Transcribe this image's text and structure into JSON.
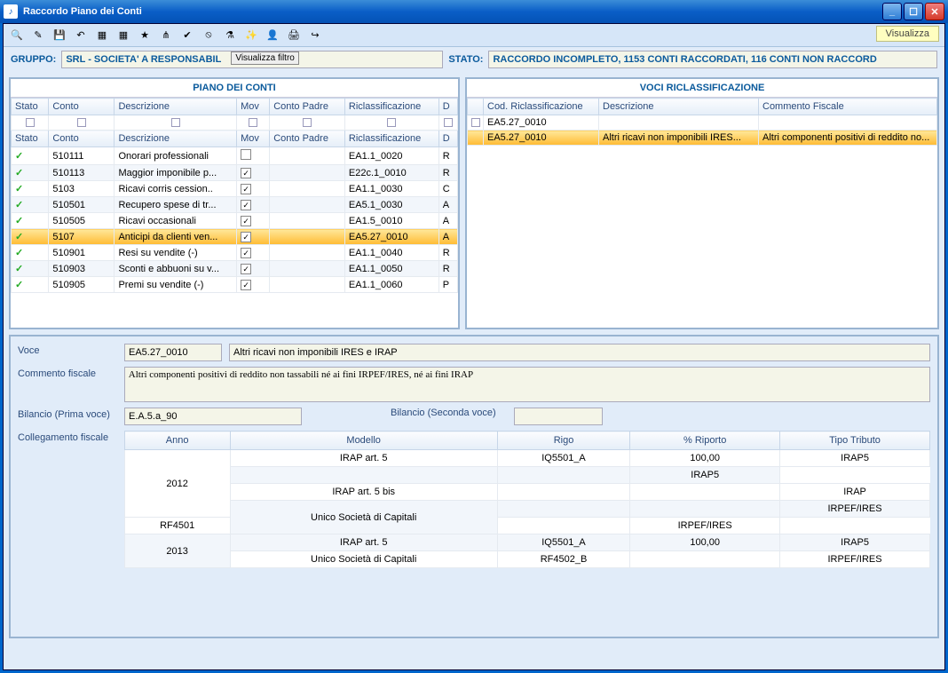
{
  "window": {
    "title": "Raccordo Piano dei Conti"
  },
  "toolbar": {
    "visualizza": "Visualizza",
    "filter_btn": "Visualizza filtro"
  },
  "filter": {
    "gruppo_label": "GRUPPO:",
    "gruppo_value": "SRL - SOCIETA' A RESPONSABIL",
    "stato_label": "STATO:",
    "stato_value": "RACCORDO INCOMPLETO, 1153 CONTI RACCORDATI, 116 CONTI NON RACCORD"
  },
  "panel_left": {
    "title": "PIANO DEI CONTI",
    "cols": [
      "Stato",
      "Conto",
      "Descrizione",
      "Mov",
      "Conto Padre",
      "Riclassificazione",
      "D"
    ],
    "rows": [
      {
        "conto": "510111",
        "descr": "Onorari professionali",
        "mov": false,
        "padre": "",
        "ricl": "EA1.1_0020",
        "d": "R"
      },
      {
        "conto": "510113",
        "descr": "Maggior imponibile p...",
        "mov": true,
        "padre": "",
        "ricl": "E22c.1_0010",
        "d": "R"
      },
      {
        "conto": "5103",
        "descr": "Ricavi corris cession..",
        "mov": true,
        "padre": "",
        "ricl": "EA1.1_0030",
        "d": "C"
      },
      {
        "conto": "510501",
        "descr": "Recupero spese di tr...",
        "mov": true,
        "padre": "",
        "ricl": "EA5.1_0030",
        "d": "A"
      },
      {
        "conto": "510505",
        "descr": "Ricavi occasionali",
        "mov": true,
        "padre": "",
        "ricl": "EA1.5_0010",
        "d": "A"
      },
      {
        "conto": "5107",
        "descr": "Anticipi da clienti ven...",
        "mov": true,
        "padre": "",
        "ricl": "EA5.27_0010",
        "d": "A",
        "selected": true
      },
      {
        "conto": "510901",
        "descr": "Resi su vendite (-)",
        "mov": true,
        "padre": "",
        "ricl": "EA1.1_0040",
        "d": "R"
      },
      {
        "conto": "510903",
        "descr": "Sconti e abbuoni su v...",
        "mov": true,
        "padre": "",
        "ricl": "EA1.1_0050",
        "d": "R"
      },
      {
        "conto": "510905",
        "descr": "Premi su vendite (-)",
        "mov": true,
        "padre": "",
        "ricl": "EA1.1_0060",
        "d": "P"
      }
    ]
  },
  "panel_right": {
    "title": "VOCI RICLASSIFICAZIONE",
    "cols": [
      "Cod. Riclassificazione",
      "Descrizione",
      "Commento Fiscale"
    ],
    "rows": [
      {
        "cod": "EA5.27_0010",
        "descr": "",
        "comm": ""
      },
      {
        "cod": "EA5.27_0010",
        "descr": "Altri ricavi non imponibili IRES...",
        "comm": "Altri componenti positivi di reddito no...",
        "selected": true
      }
    ]
  },
  "details": {
    "voce_label": "Voce",
    "voce_code": "EA5.27_0010",
    "voce_desc": "Altri ricavi non imponibili IRES e IRAP",
    "commento_label": "Commento fiscale",
    "commento_value": "Altri componenti positivi di reddito non tassabili né ai fini IRPEF/IRES, né ai fini IRAP",
    "bilancio1_label": "Bilancio (Prima voce)",
    "bilancio1_value": "E.A.5.a_90",
    "bilancio2_label": "Bilancio (Seconda voce)",
    "bilancio2_value": "",
    "colleg_label": "Collegamento fiscale",
    "fcols": [
      "Anno",
      "Modello",
      "Rigo",
      "% Riporto",
      "Tipo Tributo"
    ],
    "frows": [
      {
        "anno": "2012",
        "modello": "IRAP art. 5",
        "rigo": "IQ5501_A",
        "riporto": "100,00",
        "tipo": "IRAP5",
        "rs_anno": 4,
        "rs_mod": 1
      },
      {
        "anno": "",
        "modello": "",
        "rigo": "",
        "riporto": "",
        "tipo": "IRAP5"
      },
      {
        "anno": "",
        "modello": "IRAP art. 5 bis",
        "rigo": "",
        "riporto": "",
        "tipo": "IRAP",
        "rs_mod": 1
      },
      {
        "anno": "",
        "modello": "Unico Società di Capitali",
        "rigo": "",
        "riporto": "",
        "tipo": "IRPEF/IRES",
        "rs_mod": 2
      },
      {
        "anno": "",
        "modello": "",
        "rigo": "RF4501",
        "riporto": "",
        "tipo": "IRPEF/IRES"
      },
      {
        "anno": "2013",
        "modello": "IRAP art. 5",
        "rigo": "IQ5501_A",
        "riporto": "100,00",
        "tipo": "IRAP5",
        "rs_anno": 2,
        "rs_mod": 1
      },
      {
        "anno": "",
        "modello": "Unico Società di Capitali",
        "rigo": "RF4502_B",
        "riporto": "",
        "tipo": "IRPEF/IRES",
        "rs_mod": 1
      }
    ]
  }
}
